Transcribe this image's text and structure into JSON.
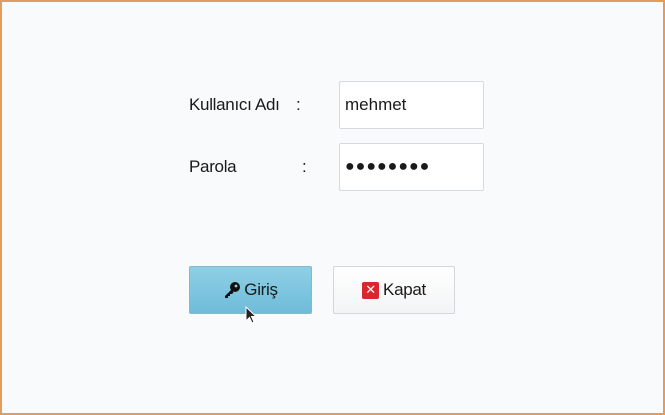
{
  "form": {
    "username_label": "Kullanıcı Adı",
    "username_colon": ":",
    "username_value": "mehmet",
    "password_label": "Parola",
    "password_colon": ":",
    "password_value": "●●●●●●●●"
  },
  "buttons": {
    "login_label": "Giriş",
    "login_icon": "key-icon",
    "close_label": "Kapat",
    "close_icon": "close-x-icon"
  },
  "colors": {
    "window_border": "#e49b5c",
    "login_button": "#7fc6df",
    "close_icon": "#d9262e"
  }
}
